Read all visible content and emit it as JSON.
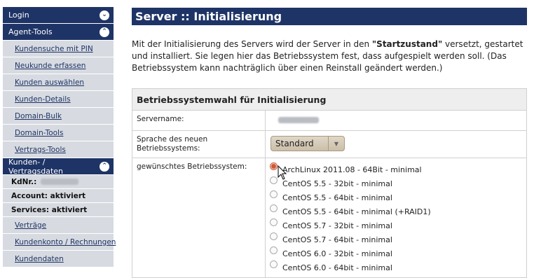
{
  "sidebar": {
    "login": "Login",
    "agent_tools": "Agent-Tools",
    "agent_links": [
      "Kundensuche mit PIN",
      "Neukunde erfassen",
      "Kunden auswählen",
      "Kunden-Details",
      "Domain-Bulk",
      "Domain-Tools",
      "Vertrags-Tools"
    ],
    "customer_section": "Kunden- / Vertragsdaten",
    "kdnr_label": "KdNr.:",
    "account_status": "Account: aktiviert",
    "services_status": "Services: aktiviert",
    "customer_links": [
      "Verträge",
      "Kundenkonto / Rechnungen",
      "Kundendaten"
    ]
  },
  "main": {
    "title": "Server :: Initialisierung",
    "intro_pre": "Mit der Initialisierung des Servers wird der Server in den ",
    "intro_bold": "\"Startzustand\"",
    "intro_post": " versetzt, gestartet und installiert. Sie legen hier das Betriebssystem fest, dass aufgespielt werden soll. (Das Betriebssystem kann nachträglich über einen Reinstall geändert werden.)",
    "form_title": "Betriebssystemwahl für Initialisierung",
    "servername_label": "Servername:",
    "language_label": "Sprache des neuen Betriebssystems:",
    "language_value": "Standard",
    "os_label": "gewünschtes Betriebssystem:",
    "os_options": [
      "ArchLinux 2011.08 - 64Bit - minimal",
      "CentOS 5.5 - 32bit - minimal",
      "CentOS 5.5 - 64bit - minimal",
      "CentOS 5.5 - 64bit - minimal (+RAID1)",
      "CentOS 5.7 - 32bit - minimal",
      "CentOS 5.7 - 64bit - minimal",
      "CentOS 6.0 - 32bit - minimal",
      "CentOS 6.0 - 64bit - minimal"
    ],
    "selected_index": 0
  }
}
